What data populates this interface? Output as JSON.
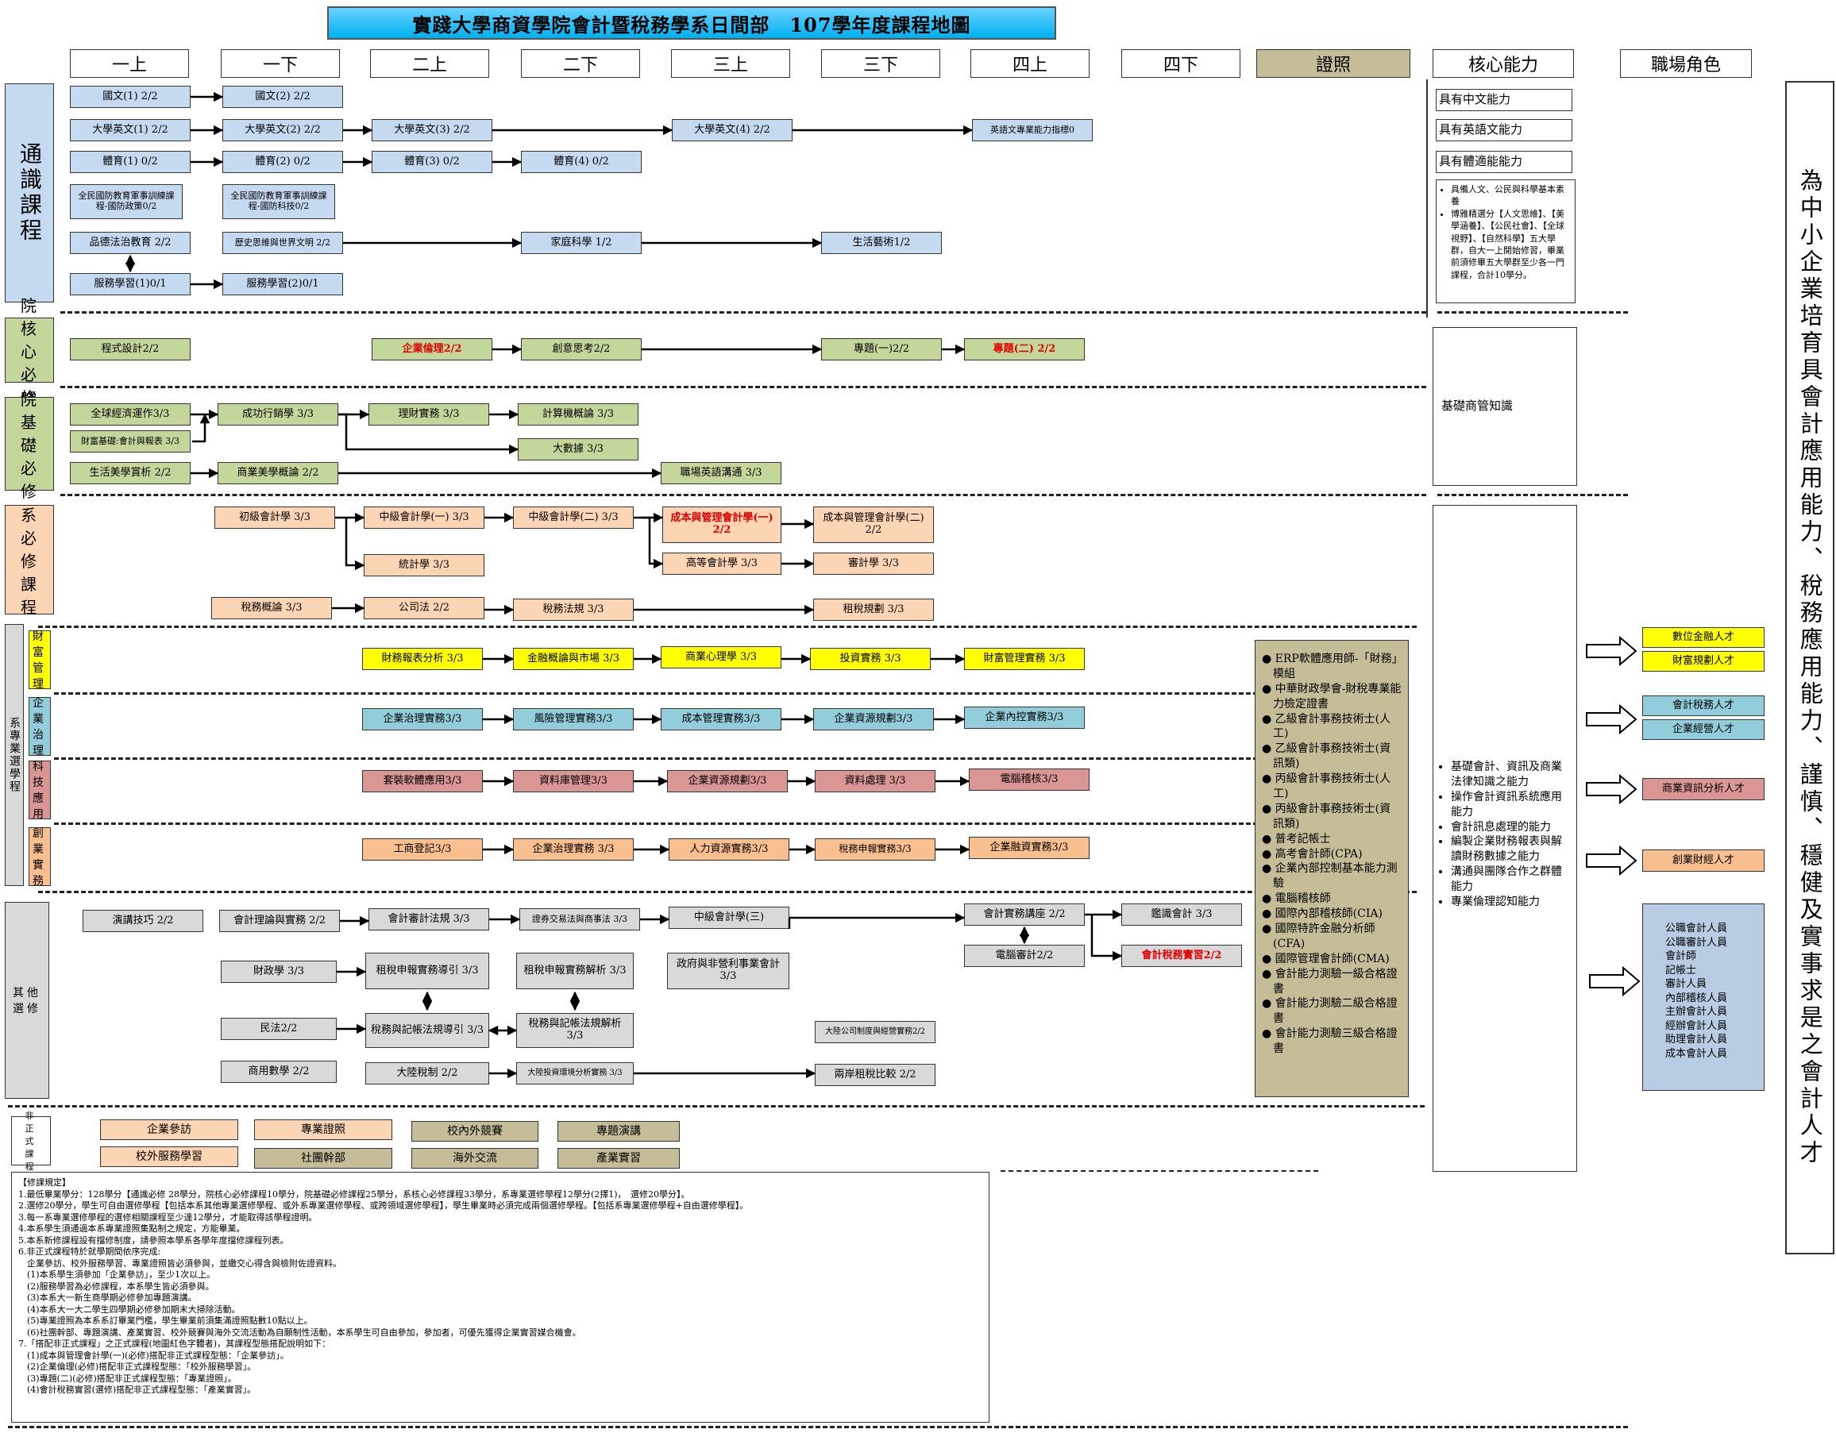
{
  "title": "實踐大學商資學院會計暨稅務學系日間部　107學年度課程地圖",
  "columns": [
    "一上",
    "一下",
    "二上",
    "二下",
    "三上",
    "三下",
    "四上",
    "四下",
    "證照",
    "核心能力",
    "職場角色"
  ],
  "categories": {
    "general": "通識課程",
    "college_core": "院核心必修",
    "college_basic": "院基礎必修",
    "dept_required": "系必修課程",
    "elective_group": "系專業選學程",
    "wealth": "財富管理",
    "governance": "企業治理",
    "tech": "科技應用",
    "startup": "創業實務",
    "other": "其他選修",
    "informal": "非正式課程"
  },
  "courses": {
    "g1": "國文(1) 2/2",
    "g2": "國文(2) 2/2",
    "g3": "大學英文(1) 2/2",
    "g4": "大學英文(2) 2/2",
    "g5": "大學英文(3) 2/2",
    "g6": "大學英文(4) 2/2",
    "g7": "英語文專業能力指標0",
    "g8": "體育(1) 0/2",
    "g9": "體育(2) 0/2",
    "g10": "體育(3) 0/2",
    "g11": "體育(4) 0/2",
    "g12": "全民國防教育軍事訓練課程-國防政策0/2",
    "g13": "全民國防教育軍事訓練課程-國防科技0/2",
    "g14": "品德法治教育 2/2",
    "g15": "歷史思維與世界文明 2/2",
    "g16": "家庭科學 1/2",
    "g17": "生活藝術1/2",
    "g18": "服務學習(1)0/1",
    "g19": "服務學習(2)0/1",
    "c1": "程式設計2/2",
    "c2": "企業倫理2/2",
    "c3": "創意思考2/2",
    "c4": "專題(一)2/2",
    "c5": "專題(二) 2/2",
    "b1": "全球經濟運作3/3",
    "b2": "財富基礎:會計與報表 3/3",
    "b3": "成功行銷學 3/3",
    "b4": "理財實務 3/3",
    "b5": "計算機概論 3/3",
    "b6": "大數據 3/3",
    "b7": "生活美學賞析 2/2",
    "b8": "商業美學概論 2/2",
    "b9": "職場英語溝通 3/3",
    "d1": "初級會計學 3/3",
    "d2": "中級會計學(一) 3/3",
    "d3": "中級會計學(二) 3/3",
    "d4": "成本與管理會計學(一) 2/2",
    "d5": "成本與管理會計學(二) 2/2",
    "d6": "統計學 3/3",
    "d7": "高等會計學 3/3",
    "d8": "審計學 3/3",
    "d9": "稅務概論 3/3",
    "d10": "公司法 2/2",
    "d11": "稅務法規 3/3",
    "d12": "租稅規劃 3/3",
    "w1": "財務報表分析 3/3",
    "w2": "金融概論與市場 3/3",
    "w3": "商業心理學 3/3",
    "w4": "投資實務 3/3",
    "w5": "財富管理實務 3/3",
    "v1": "企業治理實務3/3",
    "v2": "風險管理實務3/3",
    "v3": "成本管理實務3/3",
    "v4": "企業資源規劃3/3",
    "v5": "企業內控實務3/3",
    "t1": "套裝軟體應用3/3",
    "t2": "資料庫管理3/3",
    "t3": "企業資源規劃3/3",
    "t4": "資料處理 3/3",
    "t5": "電腦稽核3/3",
    "s1": "工商登記3/3",
    "s2": "企業治理實務 3/3",
    "s3": "人力資源實務3/3",
    "s4": "稅務申報實務3/3",
    "s5": "企業融資實務3/3",
    "o1": "演講技巧 2/2",
    "o2": "會計理論與實務 2/2",
    "o3": "會計審計法規 3/3",
    "o4": "證券交易法與商事法 3/3",
    "o5": "中級會計學(三)",
    "o6": "會計實務講座 2/2",
    "o7": "鑑識會計 3/3",
    "o8": "財政學 3/3",
    "o9": "租稅申報實務導引 3/3",
    "o10": "租稅申報實務解析 3/3",
    "o11": "政府與非營利事業會計 3/3",
    "o12": "電腦審計2/2",
    "o13": "會計稅務實習2/2",
    "o14": "民法2/2",
    "o15": "稅務與記帳法規導引 3/3",
    "o16": "稅務與記帳法規解析 3/3",
    "o17": "大陸公司制度與經營實務2/2",
    "o18": "商用數學 2/2",
    "o19": "大陸稅制 2/2",
    "o20": "大陸投資環境分析實務 3/3",
    "o21": "兩岸租稅比較 2/2",
    "i1": "企業參訪",
    "i2": "專業證照",
    "i3": "校內外競賽",
    "i4": "專題演講",
    "i5": "校外服務學習",
    "i6": "社團幹部",
    "i7": "海外交流",
    "i8": "產業實習"
  },
  "core": {
    "chinese": "具有中文能力",
    "english": "具有英語文能力",
    "sports": "具有體適能能力",
    "general_list": [
      "具備人文、公民與科學基本素養",
      "博雅精選分【人文思維】、【美學涵養】、【公民社會】、【全球視野】、【自然科學】五大學群，自大一上開始修習，畢業前須修畢五大學群至少各一門課程，合計10學分。"
    ],
    "business": "基礎商管知識",
    "professional_list": [
      "基礎會計、資訊及商業法律知識之能力",
      "操作會計資訊系統應用能力",
      "會計訊息處理的能力",
      "編製企業財務報表與解讀財務數據之能力",
      "溝通與團隊合作之群體能力",
      "專業倫理認知能力"
    ]
  },
  "certificates": [
    "ERP軟體應用師-「財務」模組",
    "中華財政學會-財稅專業能力檢定證書",
    "乙級會計事務技術士(人工)",
    "乙級會計事務技術士(資訊類)",
    "丙級會計事務技術士(人工)",
    "丙級會計事務技術士(資訊類)",
    "普考記帳士",
    "高考會計師(CPA)",
    "企業內部控制基本能力測驗",
    "電腦稽核師",
    "國際內部稽核師(CIA)",
    "國際特許金融分析師(CFA)",
    "國際管理會計師(CMA)",
    "會計能力測驗一級合格證書",
    "會計能力測驗二級合格證書",
    "會計能力測驗三級合格證書"
  ],
  "roles": {
    "r1": "數位金融人才",
    "r2": "財富規劃人才",
    "r3": "會計稅務人才",
    "r4": "企業經營人才",
    "r5": "商業資訊分析人才",
    "r6": "創業財經人才",
    "list": [
      "公職會計人員",
      "公職審計人員",
      "會計師",
      "記帳士",
      "審計人員",
      "內部稽核人員",
      "主辦會計人員",
      "經辦會計人員",
      "助理會計人員",
      "成本會計人員"
    ]
  },
  "vision": "為中小企業培育具會計應用能力、稅務應用能力、謹慎、穩健及實事求是之會計人才",
  "notes": {
    "title": "【修課規定】",
    "lines": [
      "1.最低畢業學分：128學分【通識必修 28學分，院核心必修課程10學分，院基礎必修課程25學分，系核心必修課程33學分，系專業選修學程12學分(2擇1)，　選修20學分】。",
      "2.選修20學分，學生可自由選修學程【包括本系其他專業選修學程、或外系專業選修學程、或跨領域選修學程】，學生畢業時必須完成兩個選修學程。【包括系專業選修學程+自由選修學程】。",
      "3.每一系專業選修學程的選修相關課程至少達12學分，才能取得該學程證明。",
      "4.本系學生須通過本系專業證照集點制之規定，方能畢業。",
      "5.本系新修課程設有擋修制度，請參照本學系各學年度擋修課程列表。",
      "6.非正式課程特於就學期間依序完成:",
      "　企業參訪、校外服務學習、專業證照皆必須參與，並繳交心得含與檢附佐證資料。",
      "　(1)本系學生須參加「企業參訪」，至少1次以上。",
      "　(2)服務學習為必修課程，本系學生皆必須參與。",
      "　(3)本系大一新生商學期必修參加專題演講。",
      "　(4)本系大一大二學生四學期必修參加期末大掃除活動。",
      "　(5)專業證照為本系系訂畢業門檻，學生畢業前須集滿證照點數10點以上。",
      "　(6)社團幹部、專題演講、產業實習、校外競賽與海外交流活動為自願制性活動，本系學生可自由參加，參加者，可優先獲得企業實習媒合機會。",
      "7.「搭配非正式課程」之正式課程(地圖紅色字體者)，其課程型態搭配說明如下：",
      "　(1)成本與管理會計學(一)(必修)搭配非正式課程型態：「企業參訪」。",
      "　(2)企業倫理(必修)搭配非正式課程型態：「校外服務學習」。",
      "　(3)專題(二)(必修)搭配非正式課程型態：「專業證照」。",
      "　(4)會計稅務實習(選修)搭配非正式課程型態：「產業實習」。"
    ]
  }
}
